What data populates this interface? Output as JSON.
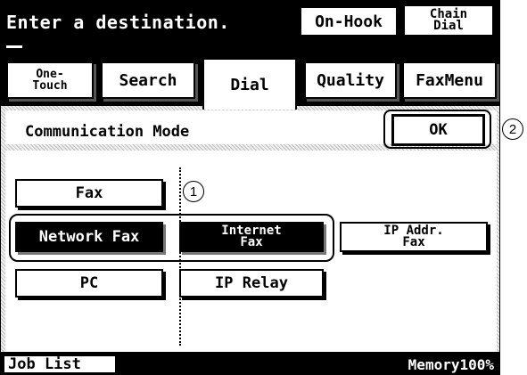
{
  "header": {
    "prompt": "Enter a destination.",
    "on_hook_label": "On-Hook",
    "chain_dial_line1": "Chain",
    "chain_dial_line2": "Dial"
  },
  "tabs": [
    {
      "line1": "One-",
      "line2": "Touch"
    },
    {
      "label": "Search"
    },
    {
      "label": "Dial",
      "active": true
    },
    {
      "label": "Quality"
    },
    {
      "label": "FaxMenu"
    }
  ],
  "mode": {
    "title": "Communication Mode",
    "ok_label": "OK"
  },
  "modes": {
    "fax": "Fax",
    "network_fax": "Network Fax",
    "internet_fax_line1": "Internet",
    "internet_fax_line2": "Fax",
    "ip_addr_fax_line1": "IP Addr.",
    "ip_addr_fax_line2": "Fax",
    "pc": "PC",
    "ip_relay": "IP Relay"
  },
  "footer": {
    "job_list": "Job List",
    "memory": "Memory100%"
  },
  "callouts": {
    "one": "1",
    "two": "2"
  }
}
